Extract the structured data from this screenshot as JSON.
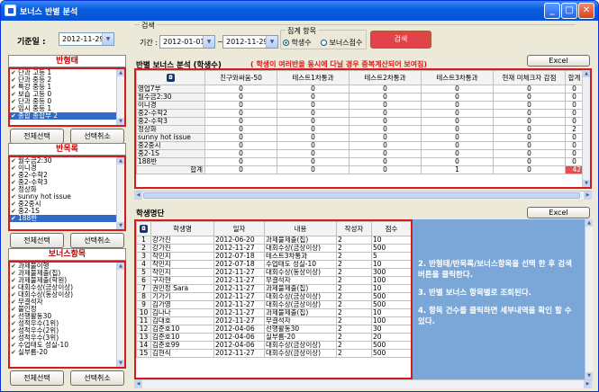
{
  "window": {
    "title": "보너스 반별 분석",
    "icon": "app-icon",
    "minimize": "_",
    "maximize": "□",
    "close": "✕"
  },
  "top": {
    "base_date_label": "기준일 :",
    "base_date_value": "2012-11-29",
    "search_group_label": "검색",
    "period_label": "기간 :",
    "period_from": "2012-01-01",
    "period_sep": "~",
    "period_to": "2012-11-29",
    "agg_group_label": "집계 항목",
    "radio_student": "학생수",
    "radio_bonus": "보너스점수",
    "search_button": "검색"
  },
  "left": {
    "class_type": {
      "header": "반형태",
      "items": [
        "단과 고등 1",
        "단과 중등 2",
        "특강 중등 1",
        "보습 고등 0",
        "단과 중등 0",
        "임시 중등 1",
        "종합 종합부 2"
      ],
      "selected_index": 6,
      "select_all": "전체선택",
      "deselect": "선택취소"
    },
    "class_list": {
      "header": "반목록",
      "items": [
        "월수금2:30",
        "이니경",
        "중2-수학2",
        "중2-수학3",
        "정상화",
        "sunny hot issue",
        "중2중시",
        "중2-1S",
        "188반"
      ],
      "selected_index": 8,
      "select_all": "전체선택",
      "deselect": "선택취소"
    },
    "bonus_items": {
      "header": "보너스항목",
      "items": [
        "과제불이행",
        "과제불제출(집)",
        "과제불제출(학원)",
        "대회수상(금상이상)",
        "대회수상(동상이상)",
        "무결석자",
        "불인정",
        "선행활동30",
        "성적우수(1위)",
        "성적우수(2위)",
        "성적우수(3위)",
        "수업태도 성실-10",
        "실부름-20"
      ],
      "select_all": "전체선택",
      "deselect": "선택취소"
    }
  },
  "analysis": {
    "title": "반별 보너스 분석 (학생수)",
    "warning": "( 학생이 여러반을 동시에 다닐 경우 중복계산되어 보여짐)",
    "excel": "Excel",
    "columns": [
      "친구와싸움-50",
      "테스트1차통과",
      "테스트2차통과",
      "테스트3차통과",
      "현재 미체크자 감점",
      "합계"
    ],
    "rows": [
      {
        "name": "영업7부",
        "v": [
          "0",
          "0",
          "0",
          "0",
          "0",
          "0"
        ]
      },
      {
        "name": "월수금2:30",
        "v": [
          "0",
          "0",
          "0",
          "0",
          "0",
          "0"
        ]
      },
      {
        "name": "이니경",
        "v": [
          "0",
          "0",
          "0",
          "0",
          "0",
          "0"
        ]
      },
      {
        "name": "중2-수학2",
        "v": [
          "0",
          "0",
          "0",
          "0",
          "0",
          "0"
        ]
      },
      {
        "name": "중2-수학3",
        "v": [
          "0",
          "0",
          "0",
          "0",
          "0",
          "0"
        ]
      },
      {
        "name": "정상화",
        "v": [
          "0",
          "0",
          "0",
          "0",
          "0",
          "2"
        ]
      },
      {
        "name": "sunny hot issue",
        "v": [
          "0",
          "0",
          "0",
          "0",
          "0",
          "0"
        ]
      },
      {
        "name": "중2중시",
        "v": [
          "0",
          "0",
          "0",
          "0",
          "0",
          "0"
        ]
      },
      {
        "name": "중2-1S",
        "v": [
          "0",
          "0",
          "0",
          "0",
          "0",
          "0"
        ]
      },
      {
        "name": "188반",
        "v": [
          "0",
          "0",
          "0",
          "0",
          "0",
          "0"
        ]
      }
    ],
    "total": {
      "name": "합계",
      "v": [
        "0",
        "0",
        "0",
        "1",
        "0",
        "42"
      ]
    }
  },
  "students": {
    "title": "학생명단",
    "excel": "Excel",
    "columns": [
      "학생명",
      "일자",
      "내용",
      "작성자",
      "점수"
    ],
    "rows": [
      [
        "1",
        "강가진",
        "2012-06-20",
        "과제불제출(집)",
        "2",
        "10"
      ],
      [
        "2",
        "강가진",
        "2012-11-27",
        "대회수상(금상이상)",
        "2",
        "500"
      ],
      [
        "3",
        "작민지",
        "2012-07-18",
        "테스트3차통과",
        "2",
        "5"
      ],
      [
        "4",
        "작민지",
        "2012-07-18",
        "수업태도 성실-10",
        "2",
        "10"
      ],
      [
        "5",
        "작민지",
        "2012-11-27",
        "대회수상(동상이상)",
        "2",
        "300"
      ],
      [
        "6",
        "구자현",
        "2012-11-27",
        "무결석자",
        "2",
        "100"
      ],
      [
        "7",
        "권민정 Sara",
        "2012-11-27",
        "과제불제출(집)",
        "2",
        "10"
      ],
      [
        "8",
        "기가기",
        "2012-11-27",
        "대회수상(금상이상)",
        "2",
        "500"
      ],
      [
        "9",
        "김가영",
        "2012-11-27",
        "대회수상(금상이상)",
        "2",
        "500"
      ],
      [
        "10",
        "김나나",
        "2012-11-27",
        "과제불제출(집)",
        "2",
        "10"
      ],
      [
        "11",
        "김대호",
        "2012-11-27",
        "무결석자",
        "2",
        "100"
      ],
      [
        "12",
        "김준호10",
        "2012-04-06",
        "선행활동30",
        "2",
        "30"
      ],
      [
        "13",
        "김준호10",
        "2012-04-06",
        "실부름-20",
        "2",
        "20"
      ],
      [
        "14",
        "김준호99",
        "2012-04-06",
        "대회수상(금상이상)",
        "2",
        "500"
      ],
      [
        "15",
        "김현식",
        "2012-11-27",
        "대회수상(금상이상)",
        "2",
        "500"
      ]
    ]
  },
  "notes": [
    "2. 반형태/반목록/보너스항목을 선택 한 후 검색 버튼을 클릭한다.",
    "3. 반별 보너스 항목별로 조회된다.",
    "4. 항목 건수를 클릭하면 세부내역을 확인 할 수 있다."
  ],
  "colors": {
    "accent_red": "#d71b1b",
    "titlebar": "#0a5ee0",
    "note_bg": "#7aa7d8"
  }
}
